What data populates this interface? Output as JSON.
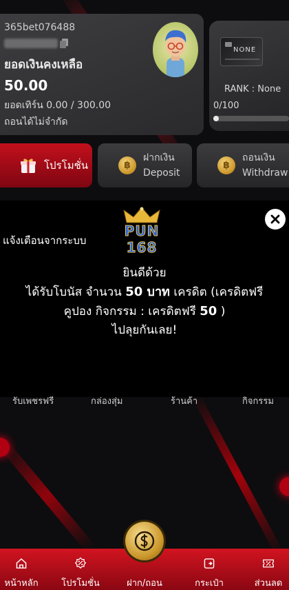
{
  "account": {
    "username": "365bet076488",
    "balance_label": "ยอดเงินคงเหลือ",
    "balance": "50.00",
    "turnover": "ยอดเทิร์น 0.00 / 300.00",
    "withdraw_limit": "ถอนได้ไม่จำกัด"
  },
  "rank": {
    "badge_text": "NONE",
    "label": "RANK : None",
    "progress_text": "0/100",
    "progress_fraction": 0
  },
  "actions": {
    "promo_label": "โปรโมชั่น",
    "deposit_th": "ฝากเงิน",
    "deposit_en": "Deposit",
    "withdraw_th": "ถอนเงิน",
    "withdraw_en": "Withdraw"
  },
  "notice": {
    "title": "แจ้งเตือนจากระบบ",
    "logo_top": "PUN",
    "logo_bottom": "168",
    "line1": "ยินดีด้วย",
    "line2_a": "ได้รับโบนัส จำนวน ",
    "line2_amount": "50 บาท",
    "line2_b": " เครดิต (เครดิตฟรี",
    "line3_a": "คูปอง กิจกรรม : เครดิตฟรี ",
    "line3_amount": "50",
    "line3_b": " )",
    "line4": "ไปลุยกันเลย!"
  },
  "categories": [
    "รับเพชรฟรี",
    "กล่องสุ่ม",
    "ร้านค้า",
    "กิจกรรม"
  ],
  "bottom_nav": {
    "home": "หน้าหลัก",
    "promo": "โปรโมชั่น",
    "deposit_withdraw": "ฝาก/ถอน",
    "wallet": "กระเป๋า",
    "commission": "ส่วนลด"
  },
  "colors": {
    "accent_red": "#c2101c",
    "gold": "#c99427"
  }
}
